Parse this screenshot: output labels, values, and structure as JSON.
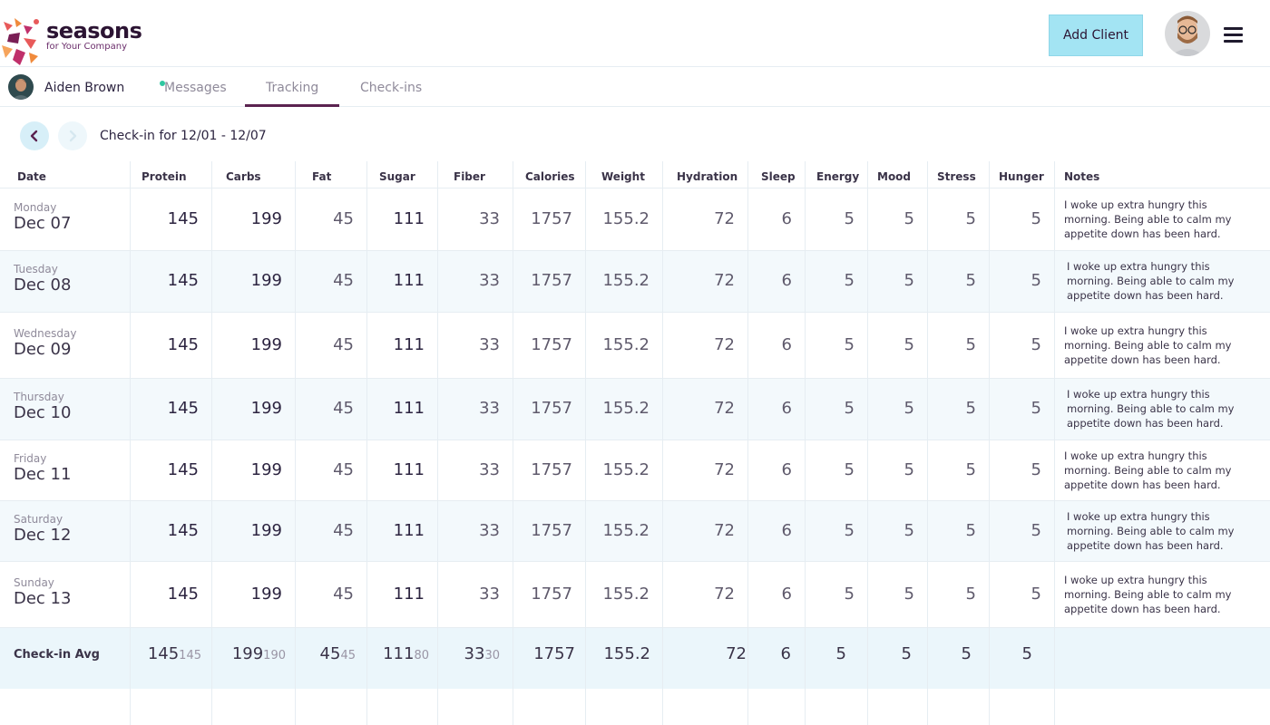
{
  "brand": {
    "name": "seasons",
    "tagline": "for Your Company"
  },
  "header": {
    "add_client_label": "Add Client"
  },
  "client": {
    "name": "Aiden Brown"
  },
  "tabs": [
    {
      "label": "Messages",
      "active": false,
      "has_dot": true
    },
    {
      "label": "Tracking",
      "active": true,
      "has_dot": false
    },
    {
      "label": "Check-ins",
      "active": false,
      "has_dot": false
    }
  ],
  "week": {
    "label": "Check-in for 12/01 - 12/07"
  },
  "columns": [
    "Date",
    "Protein",
    "Carbs",
    "Fat",
    "Sugar",
    "Fiber",
    "Calories",
    "Weight",
    "Hydration",
    "Sleep",
    "Energy",
    "Mood",
    "Stress",
    "Hunger",
    "Notes"
  ],
  "rows": [
    {
      "day": "Monday",
      "date": "Dec 07",
      "protein": "145",
      "carbs": "199",
      "fat": "45",
      "sugar": "111",
      "fiber": "33",
      "calories": "1757",
      "weight": "155.2",
      "hydration": "72",
      "sleep": "6",
      "energy": "5",
      "mood": "5",
      "stress": "5",
      "hunger": "5",
      "notes": "I woke up extra hungry this morning. Being able to calm my appetite down has been hard."
    },
    {
      "day": "Tuesday",
      "date": "Dec 08",
      "protein": "145",
      "carbs": "199",
      "fat": "45",
      "sugar": "111",
      "fiber": "33",
      "calories": "1757",
      "weight": "155.2",
      "hydration": "72",
      "sleep": "6",
      "energy": "5",
      "mood": "5",
      "stress": "5",
      "hunger": "5",
      "notes": "I woke up extra hungry this morning. Being able to calm my appetite down has been hard."
    },
    {
      "day": "Wednesday",
      "date": "Dec 09",
      "protein": "145",
      "carbs": "199",
      "fat": "45",
      "sugar": "111",
      "fiber": "33",
      "calories": "1757",
      "weight": "155.2",
      "hydration": "72",
      "sleep": "6",
      "energy": "5",
      "mood": "5",
      "stress": "5",
      "hunger": "5",
      "notes": "I woke up extra hungry this morning. Being able to calm my appetite down has been hard."
    },
    {
      "day": "Thursday",
      "date": "Dec 10",
      "protein": "145",
      "carbs": "199",
      "fat": "45",
      "sugar": "111",
      "fiber": "33",
      "calories": "1757",
      "weight": "155.2",
      "hydration": "72",
      "sleep": "6",
      "energy": "5",
      "mood": "5",
      "stress": "5",
      "hunger": "5",
      "notes": "I woke up extra hungry this morning. Being able to calm my appetite down has been hard."
    },
    {
      "day": "Friday",
      "date": "Dec 11",
      "protein": "145",
      "carbs": "199",
      "fat": "45",
      "sugar": "111",
      "fiber": "33",
      "calories": "1757",
      "weight": "155.2",
      "hydration": "72",
      "sleep": "6",
      "energy": "5",
      "mood": "5",
      "stress": "5",
      "hunger": "5",
      "notes": "I woke up extra hungry this morning. Being able to calm my appetite down has been hard."
    },
    {
      "day": "Saturday",
      "date": "Dec 12",
      "protein": "145",
      "carbs": "199",
      "fat": "45",
      "sugar": "111",
      "fiber": "33",
      "calories": "1757",
      "weight": "155.2",
      "hydration": "72",
      "sleep": "6",
      "energy": "5",
      "mood": "5",
      "stress": "5",
      "hunger": "5",
      "notes": "I woke up extra hungry this morning. Being able to calm my appetite down has been hard."
    },
    {
      "day": "Sunday",
      "date": "Dec 13",
      "protein": "145",
      "carbs": "199",
      "fat": "45",
      "sugar": "111",
      "fiber": "33",
      "calories": "1757",
      "weight": "155.2",
      "hydration": "72",
      "sleep": "6",
      "energy": "5",
      "mood": "5",
      "stress": "5",
      "hunger": "5",
      "notes": "I woke up extra hungry this morning. Being able to calm my appetite down has been hard."
    }
  ],
  "average": {
    "label": "Check-in Avg",
    "protein": "145",
    "protein_target": "145",
    "carbs": "199",
    "carbs_target": "190",
    "fat": "45",
    "fat_target": "45",
    "sugar": "111",
    "sugar_target": "80",
    "fiber": "33",
    "fiber_target": "30",
    "calories": "1757",
    "weight": "155.2",
    "hydration": "72",
    "sleep": "6",
    "energy": "5",
    "mood": "5",
    "stress": "5",
    "hunger": "5"
  },
  "colors": {
    "accent": "#a3e4f3",
    "tab_underline": "#5b2350",
    "row_alt": "#f3f9fc",
    "online_dot": "#2fc7a1"
  },
  "icons": {
    "prev": "chevron-left-icon",
    "next": "chevron-right-icon",
    "menu": "hamburger-icon"
  }
}
